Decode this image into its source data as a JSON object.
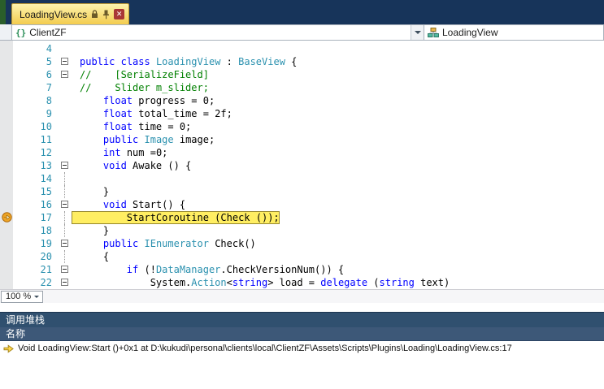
{
  "tab": {
    "title": "LoadingView.cs"
  },
  "nav": {
    "project": "ClientZF",
    "type": "LoadingView"
  },
  "colors": {
    "tab_active": "#f3cc4e",
    "title_bar": "#17345a",
    "statement_highlight": "#ffee62",
    "keyword": "#0000ff",
    "type": "#2b91af",
    "comment": "#008000",
    "line_number": "#2b91af",
    "panel_header": "#30506f"
  },
  "editor": {
    "zoom": "100 %",
    "lines": [
      {
        "n": 4,
        "fold": "",
        "seg": []
      },
      {
        "n": 5,
        "fold": "box",
        "seg": [
          [
            "kw",
            "public"
          ],
          [
            "pl",
            " "
          ],
          [
            "kw",
            "class"
          ],
          [
            "pl",
            " "
          ],
          [
            "ty",
            "LoadingView"
          ],
          [
            "pl",
            " : "
          ],
          [
            "ty",
            "BaseView"
          ],
          [
            "pl",
            " {"
          ]
        ]
      },
      {
        "n": 6,
        "fold": "box",
        "seg": [
          [
            "cm",
            "//    [SerializeField]"
          ]
        ]
      },
      {
        "n": 7,
        "fold": "",
        "seg": [
          [
            "cm",
            "//    Slider m_slider;"
          ]
        ]
      },
      {
        "n": 8,
        "fold": "",
        "seg": [
          [
            "pl",
            "    "
          ],
          [
            "kw",
            "float"
          ],
          [
            "pl",
            " progress = 0;"
          ]
        ]
      },
      {
        "n": 9,
        "fold": "",
        "seg": [
          [
            "pl",
            "    "
          ],
          [
            "kw",
            "float"
          ],
          [
            "pl",
            " total_time = 2f;"
          ]
        ]
      },
      {
        "n": 10,
        "fold": "",
        "seg": [
          [
            "pl",
            "    "
          ],
          [
            "kw",
            "float"
          ],
          [
            "pl",
            " time = 0;"
          ]
        ]
      },
      {
        "n": 11,
        "fold": "",
        "seg": [
          [
            "pl",
            "    "
          ],
          [
            "kw",
            "public"
          ],
          [
            "pl",
            " "
          ],
          [
            "ty",
            "Image"
          ],
          [
            "pl",
            " image;"
          ]
        ]
      },
      {
        "n": 12,
        "fold": "",
        "seg": [
          [
            "pl",
            "    "
          ],
          [
            "kw",
            "int"
          ],
          [
            "pl",
            " num =0;"
          ]
        ]
      },
      {
        "n": 13,
        "fold": "box",
        "seg": [
          [
            "pl",
            "    "
          ],
          [
            "kw",
            "void"
          ],
          [
            "pl",
            " Awake () {"
          ]
        ]
      },
      {
        "n": 14,
        "fold": "guide",
        "seg": []
      },
      {
        "n": 15,
        "fold": "guide",
        "seg": [
          [
            "pl",
            "    }"
          ]
        ]
      },
      {
        "n": 16,
        "fold": "box",
        "seg": [
          [
            "pl",
            "    "
          ],
          [
            "kw",
            "void"
          ],
          [
            "pl",
            " Start() {"
          ]
        ]
      },
      {
        "n": 17,
        "fold": "guide",
        "hl": true,
        "cur": true,
        "seg": [
          [
            "pl",
            "        StartCoroutine (Check ());"
          ]
        ]
      },
      {
        "n": 18,
        "fold": "guide",
        "seg": [
          [
            "pl",
            "    }"
          ]
        ]
      },
      {
        "n": 19,
        "fold": "box",
        "seg": [
          [
            "pl",
            "    "
          ],
          [
            "kw",
            "public"
          ],
          [
            "pl",
            " "
          ],
          [
            "ty",
            "IEnumerator"
          ],
          [
            "pl",
            " Check()"
          ]
        ]
      },
      {
        "n": 20,
        "fold": "guide",
        "seg": [
          [
            "pl",
            "    {"
          ]
        ]
      },
      {
        "n": 21,
        "fold": "box",
        "seg": [
          [
            "pl",
            "        "
          ],
          [
            "kw",
            "if"
          ],
          [
            "pl",
            " (!"
          ],
          [
            "ty",
            "DataManager"
          ],
          [
            "pl",
            ".CheckVersionNum()) {"
          ]
        ]
      },
      {
        "n": 22,
        "fold": "box",
        "seg": [
          [
            "pl",
            "            System."
          ],
          [
            "ty",
            "Action"
          ],
          [
            "pl",
            "<"
          ],
          [
            "kw",
            "string"
          ],
          [
            "pl",
            "> load = "
          ],
          [
            "kw",
            "delegate"
          ],
          [
            "pl",
            " ("
          ],
          [
            "kw",
            "string"
          ],
          [
            "pl",
            " text)"
          ]
        ]
      }
    ]
  },
  "callstack": {
    "title": "调用堆栈",
    "column": "名称",
    "frames": [
      "Void LoadingView:Start ()+0x1 at D:\\kukudi\\personal\\clients\\local\\ClientZF\\Assets\\Scripts\\Plugins\\Loading\\LoadingView.cs:17"
    ]
  }
}
